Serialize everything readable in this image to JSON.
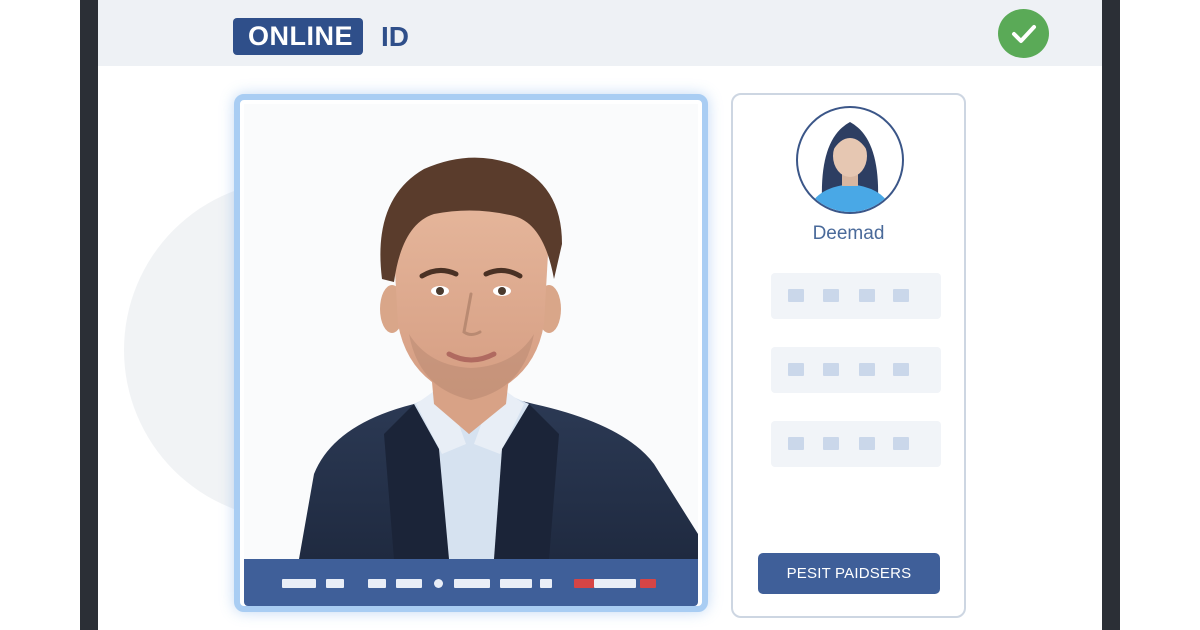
{
  "header": {
    "logo_text": "ONLINE",
    "logo_suffix": "ID",
    "status_icon": "check-circle-icon",
    "status_color": "#5aaa57"
  },
  "photo_card": {
    "image": "man-in-navy-suit-portrait"
  },
  "profile": {
    "avatar": "woman-avatar",
    "name": "Deemad",
    "action_label": "PESIT PAIDSERS"
  },
  "colors": {
    "brand": "#2f4f8a",
    "accent_border": "#a9cdf3",
    "bar": "#3f5f99",
    "warning": "#d64545"
  }
}
